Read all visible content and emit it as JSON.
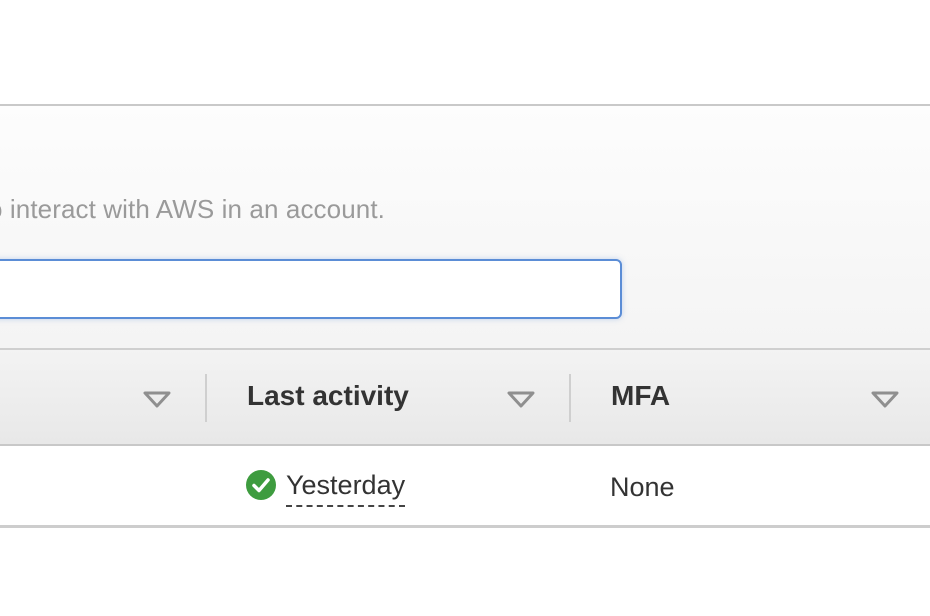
{
  "panel": {
    "description": "o interact with AWS in an account.",
    "search": {
      "value": "",
      "placeholder": ""
    }
  },
  "table": {
    "columns": [
      {
        "label": ""
      },
      {
        "label": "Last activity"
      },
      {
        "label": "MFA"
      }
    ],
    "rows": [
      {
        "last_activity": "Yesterday",
        "last_activity_status": "success",
        "mfa": "None"
      }
    ]
  },
  "colors": {
    "focus_border": "#5b8dd6",
    "success_green": "#3e9c3f",
    "header_text": "#333333",
    "muted_text": "#9a9a9a"
  },
  "icons": {
    "sort": "caret-down-icon",
    "status": "check-circle-icon"
  }
}
